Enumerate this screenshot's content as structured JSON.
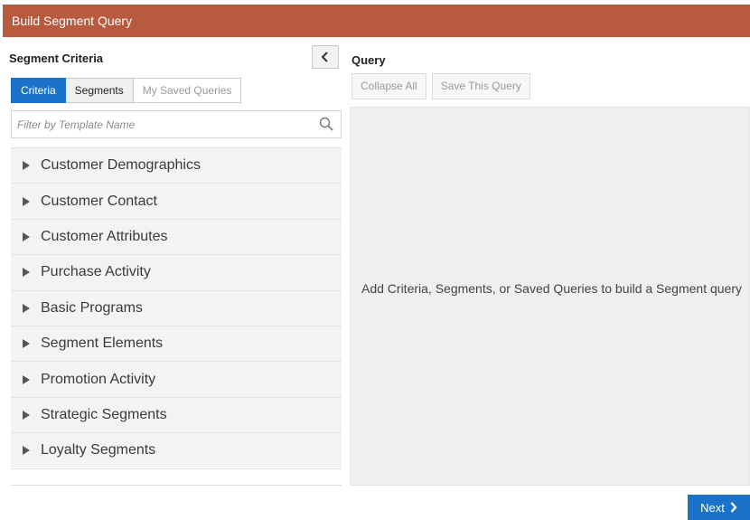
{
  "window": {
    "title": "Build Segment Query"
  },
  "left_panel": {
    "title": "Segment Criteria",
    "collapse_icon": "chevron-left-icon",
    "tabs": [
      {
        "label": "Criteria",
        "state": "active"
      },
      {
        "label": "Segments",
        "state": "normal"
      },
      {
        "label": "My Saved Queries",
        "state": "disabled"
      }
    ],
    "filter": {
      "placeholder": "Filter by Template Name",
      "icon": "search-icon"
    },
    "categories": [
      {
        "label": "Customer Demographics"
      },
      {
        "label": "Customer Contact"
      },
      {
        "label": "Customer Attributes"
      },
      {
        "label": "Purchase Activity"
      },
      {
        "label": "Basic Programs"
      },
      {
        "label": "Segment Elements"
      },
      {
        "label": "Promotion Activity"
      },
      {
        "label": "Strategic Segments"
      },
      {
        "label": "Loyalty Segments"
      }
    ]
  },
  "right_panel": {
    "title": "Query",
    "toolbar": {
      "collapse_all_label": "Collapse All",
      "save_query_label": "Save This Query"
    },
    "empty_message": "Add Criteria, Segments, or Saved Queries to build a Segment query"
  },
  "footer": {
    "next_label": "Next",
    "next_icon": "chevron-right-icon"
  },
  "colors": {
    "titlebar": "#b85a3e",
    "accent": "#1a73c8",
    "panel_bg": "#efefef"
  }
}
